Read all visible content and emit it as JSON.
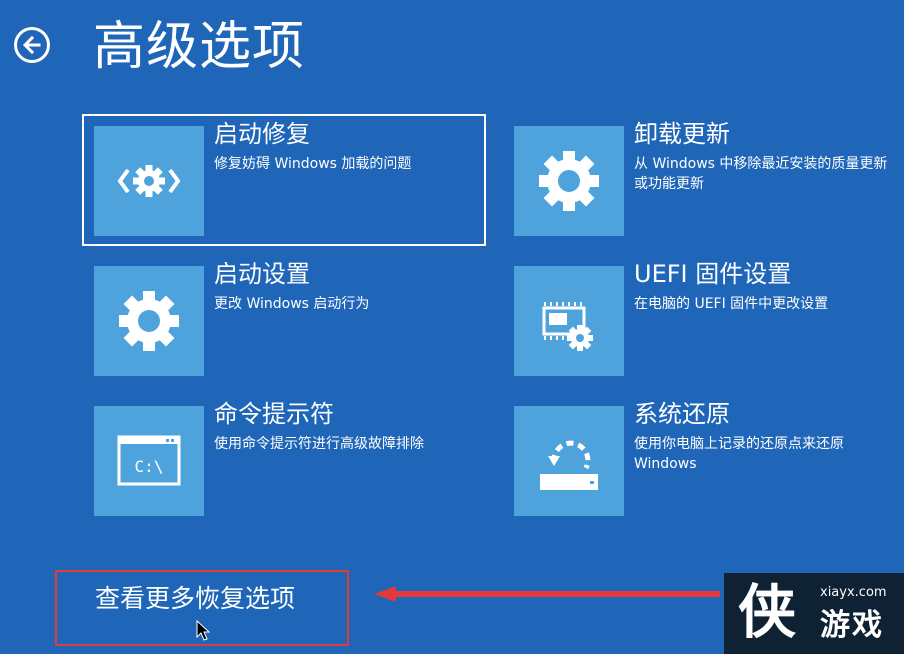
{
  "header": {
    "title": "高级选项"
  },
  "options": [
    {
      "title": "启动修复",
      "desc": "修复妨碍 Windows 加载的问题",
      "icon": "startup-repair-icon"
    },
    {
      "title": "卸载更新",
      "desc": "从 Windows 中移除最近安装的质量更新或功能更新",
      "icon": "gear-icon"
    },
    {
      "title": "启动设置",
      "desc": "更改 Windows 启动行为",
      "icon": "gear-icon"
    },
    {
      "title": "UEFI 固件设置",
      "desc": "在电脑的 UEFI 固件中更改设置",
      "icon": "firmware-chip-icon"
    },
    {
      "title": "命令提示符",
      "desc": "使用命令提示符进行高级故障排除",
      "icon": "command-prompt-icon"
    },
    {
      "title": "系统还原",
      "desc": "使用你电脑上记录的还原点来还原 Windows",
      "icon": "system-restore-icon"
    }
  ],
  "command_prompt_glyph": "C:\\",
  "footer": {
    "more_options": "查看更多恢复选项"
  },
  "watermark": {
    "logo": "侠",
    "url": "xiayx.com",
    "name": "游戏"
  },
  "colors": {
    "background": "#1f66b9",
    "tile": "#4fa3dd",
    "highlight_box": "#e03a3a"
  }
}
